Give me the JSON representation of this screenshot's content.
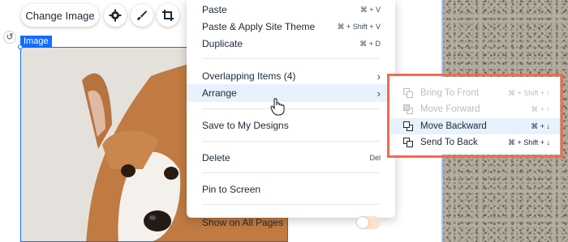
{
  "toolbar": {
    "change_image": "Change Image",
    "icons": [
      "gear-icon",
      "brush-icon",
      "crop-icon"
    ]
  },
  "element_label": "Image",
  "context_menu": {
    "items": [
      {
        "label": "Paste",
        "shortcut": "⌘ + V"
      },
      {
        "label": "Paste & Apply Site Theme",
        "shortcut": "⌘ + Shift + V"
      },
      {
        "label": "Duplicate",
        "shortcut": "⌘ + D"
      },
      {
        "label": "Overlapping Items (4)",
        "shortcut": "›"
      },
      {
        "label": "Arrange",
        "shortcut": "›"
      },
      {
        "label": "Save to My Designs",
        "shortcut": ""
      },
      {
        "label": "Delete",
        "shortcut": "Del"
      },
      {
        "label": "Pin to Screen",
        "shortcut": ""
      },
      {
        "label": "Show on All Pages",
        "shortcut": ""
      }
    ]
  },
  "arrange_submenu": {
    "items": [
      {
        "label": "Bring To Front",
        "shortcut": "⌘ + Shift + ↑",
        "enabled": false
      },
      {
        "label": "Move Forward",
        "shortcut": "⌘ + ↑",
        "enabled": false
      },
      {
        "label": "Move Backward",
        "shortcut": "⌘ + ↓",
        "enabled": true
      },
      {
        "label": "Send To Back",
        "shortcut": "⌘ + Shift + ↓",
        "enabled": true
      }
    ],
    "highlight_color": "#f26b50"
  },
  "colors": {
    "accent": "#116dff",
    "menu_hover": "#e8f1fe"
  }
}
